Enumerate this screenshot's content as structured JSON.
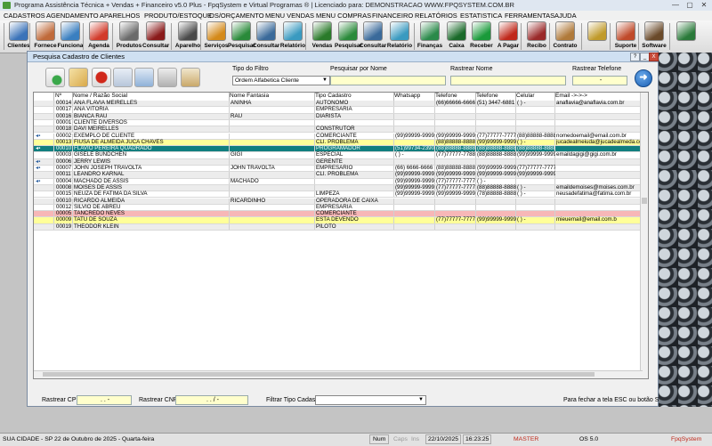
{
  "window": {
    "title": "Programa Assistência Técnica + Vendas + Financeiro v5.0 Plus - FpqSystem e Virtual Programas ® | Licenciado para: DEMONSTRACAO WWW.FPQSYSTEM.COM.BR",
    "minimize": "—",
    "maximize": "▢",
    "close": "✕"
  },
  "menu": [
    "CADASTROS",
    "AGENDAMENTO",
    "APARELHOS",
    "PRODUTO/ESTOQUE",
    "OS/ORÇAMENTO",
    "MENU VENDAS",
    "MENU COMPRAS",
    "FINANCEIRO",
    "RELATÓRIOS",
    "ESTATISTICA",
    "FERRAMENTAS",
    "AJUDA"
  ],
  "toolbar": [
    {
      "label": "Clientes",
      "icon": "clients-icon",
      "color": "#3b73b9"
    },
    {
      "label": "Fornece",
      "icon": "supplier-icon",
      "color": "#c06a3a"
    },
    {
      "label": "Funciona",
      "icon": "employee-icon",
      "color": "#3a7fc0"
    },
    {
      "label": "Agenda",
      "icon": "calendar-icon",
      "color": "#d23b2b"
    },
    {
      "label": "Produtos",
      "icon": "products-icon",
      "color": "#6a6a6a"
    },
    {
      "label": "Consultar",
      "icon": "consult-icon",
      "color": "#8a1a1a"
    },
    {
      "label": "Aparelho",
      "icon": "device-icon",
      "color": "#4a4a4a"
    },
    {
      "label": "Serviços",
      "icon": "services-icon",
      "color": "#d48a1a"
    },
    {
      "label": "Pesquisar",
      "icon": "search-icon",
      "color": "#2a8a3a"
    },
    {
      "label": "Consultar",
      "icon": "consult2-icon",
      "color": "#3a6a9a"
    },
    {
      "label": "Relatório",
      "icon": "report-icon",
      "color": "#3a9ac0"
    },
    {
      "label": "Vendas",
      "icon": "cart-icon",
      "color": "#2a7a2a"
    },
    {
      "label": "Pesquisar",
      "icon": "search2-icon",
      "color": "#2a8a3a"
    },
    {
      "label": "Consultar",
      "icon": "consult3-icon",
      "color": "#3a6a9a"
    },
    {
      "label": "Relatório",
      "icon": "report2-icon",
      "color": "#3a9ac0"
    },
    {
      "label": "Finanças",
      "icon": "finance-icon",
      "color": "#2a8a4a"
    },
    {
      "label": "Caixa",
      "icon": "cashier-icon",
      "color": "#1a6a2a"
    },
    {
      "label": "Receber",
      "icon": "receive-icon",
      "color": "#1a9a3a"
    },
    {
      "label": "A Pagar",
      "icon": "pay-icon",
      "color": "#c0281a"
    },
    {
      "label": "Recibo",
      "icon": "receipt-icon",
      "color": "#9a2a2a"
    },
    {
      "label": "Contrato",
      "icon": "contract-icon",
      "color": "#b07a3a"
    },
    {
      "label": "",
      "icon": "coins-icon",
      "color": "#c09a2a"
    },
    {
      "label": "Suporte",
      "icon": "support-icon",
      "color": "#c04a2a"
    },
    {
      "label": "Software",
      "icon": "software-icon",
      "color": "#6a4a2a"
    },
    {
      "label": "",
      "icon": "exit-icon",
      "color": "#2a7a3a"
    }
  ],
  "dialog": {
    "title": "Pesquisa Cadastro de Clientes",
    "btn_help": "?",
    "btn_min": "_",
    "btn_close": "X",
    "filter_label": "Tipo do Filtro",
    "filter_value": "Ordem Alfabetica Cliente",
    "search_name_label": "Pesquisar por Nome",
    "search_name_value": "",
    "track_name_label": "Rastrear Nome",
    "track_name_value": "",
    "track_phone_label": "Rastrear Telefone",
    "track_phone_value": "-",
    "columns": [
      "Nº",
      "Nome / Razão Social",
      "Nome Fantasia",
      "Tipo Cadastro",
      "Whatsapp",
      "Telefone",
      "Telefone",
      "Celular",
      "Email ->->->"
    ],
    "rows": [
      {
        "n": "00014",
        "nome": "ANA FLAVIA MEIRELLES",
        "fant": "ANINHA",
        "tipo": "AUTONOMO",
        "wa": "",
        "tel1": "(66)66666-6666",
        "tel2": "(51) 3447-6881",
        "cel": "( )    -",
        "email": "anaflavia@anaflavia.com.br",
        "bg": "#ececec",
        "fg": "#000",
        "mark": false
      },
      {
        "n": "00017",
        "nome": "ANA VITORIA",
        "fant": "",
        "tipo": "EMPRESARIA",
        "wa": "",
        "tel1": "",
        "tel2": "",
        "cel": "",
        "email": "",
        "bg": "#ffffff",
        "fg": "#000",
        "mark": false
      },
      {
        "n": "00016",
        "nome": "BIANCA RAU",
        "fant": "RAU",
        "tipo": "DIARISTA",
        "wa": "",
        "tel1": "",
        "tel2": "",
        "cel": "",
        "email": "",
        "bg": "#ececec",
        "fg": "#000",
        "mark": false
      },
      {
        "n": "00001",
        "nome": "CLIENTE DIVERSOS",
        "fant": "",
        "tipo": "",
        "wa": "",
        "tel1": "",
        "tel2": "",
        "cel": "",
        "email": "",
        "bg": "#ffffff",
        "fg": "#000",
        "mark": false
      },
      {
        "n": "00018",
        "nome": "DAVI MEIRELLES",
        "fant": "",
        "tipo": "CONSTRUTOR",
        "wa": "",
        "tel1": "",
        "tel2": "",
        "cel": "",
        "email": "",
        "bg": "#ececec",
        "fg": "#000",
        "mark": false
      },
      {
        "n": "00002",
        "nome": "EXEMPLO DE CLIENTE",
        "fant": "",
        "tipo": "COMERCIANTE",
        "wa": "(99)99999-9999",
        "tel1": "(99)99999-9999",
        "tel2": "(77)77777-7777",
        "cel": "(88)88888-8888",
        "email": "nomedoemail@email.com.br",
        "bg": "#ffffff",
        "fg": "#000",
        "mark": true
      },
      {
        "n": "00013",
        "nome": "FIUSA DE ALMEIDA JUCA CHAVES",
        "fant": "",
        "tipo": "CLI. PROBLEMA",
        "wa": "",
        "tel1": "(88)88888-8888",
        "tel2": "(99)99999-9999",
        "cel": "( )    -",
        "email": "jucadealmeiuda@jucadealmeda.com.br",
        "bg": "#ffff99",
        "fg": "#000",
        "mark": false
      },
      {
        "n": "00010",
        "nome": "FLAVIO PEREIRA QUADRADO",
        "fant": "",
        "tipo": "PROGRAMADOR",
        "wa": "(51)99734-2390",
        "tel1": "(88)88888-8888",
        "tel2": "(88)88888-8888",
        "cel": "(88)88888-8888",
        "email": "",
        "bg": "#117f7f",
        "fg": "#ffffff",
        "mark": true
      },
      {
        "n": "00003",
        "nome": "GISELE BUNDCHEN",
        "fant": "GIGI",
        "tipo": "ESPECIAL",
        "wa": "( )    -",
        "tel1": "(77)77777-7788",
        "tel2": "(88)88888-8888",
        "cel": "(99)99999-9999",
        "email": "emaildagigi@gigi.com.br",
        "bg": "#ffffff",
        "fg": "#000",
        "mark": false
      },
      {
        "n": "00006",
        "nome": "JERRY LEWIS",
        "fant": "",
        "tipo": "GERENTE",
        "wa": "",
        "tel1": "",
        "tel2": "",
        "cel": "",
        "email": "",
        "bg": "#ececec",
        "fg": "#000",
        "mark": true
      },
      {
        "n": "00007",
        "nome": "JOHN JOSEPH TRAVOLTA",
        "fant": "JOHN TRAVOLTA",
        "tipo": "EMPRESARIO",
        "wa": "(66) 6666-6666",
        "tel1": "(88)88888-8888",
        "tel2": "(99)99999-9999",
        "cel": "(77)77777-7777",
        "email": "",
        "bg": "#ffffff",
        "fg": "#000",
        "mark": true
      },
      {
        "n": "00011",
        "nome": "LEANDRO KARNAL",
        "fant": "",
        "tipo": "CLI. PROBLEMA",
        "wa": "(99)99999-9999",
        "tel1": "(99)99999-9999",
        "tel2": "(99)99999-9999",
        "cel": "(99)99999-9999",
        "email": "",
        "bg": "#ececec",
        "fg": "#000",
        "mark": false
      },
      {
        "n": "00004",
        "nome": "MACHADO DE ASSIS",
        "fant": "MACHADO",
        "tipo": "",
        "wa": "(99)99999-9999",
        "tel1": "(77)77777-7777",
        "tel2": "( )    -",
        "cel": "",
        "email": "",
        "bg": "#ffffff",
        "fg": "#000",
        "mark": true
      },
      {
        "n": "00008",
        "nome": "MOISES DE ASSIS",
        "fant": "",
        "tipo": "",
        "wa": "(99)99999-9999",
        "tel1": "(77)77777-7777",
        "tel2": "(88)88888-8888",
        "cel": "( )    -",
        "email": "emaildemoises@moises.com.br",
        "bg": "#ececec",
        "fg": "#000",
        "mark": false
      },
      {
        "n": "00015",
        "nome": "NEUZA DE FATIMA DA SILVA",
        "fant": "",
        "tipo": "LIMPEZA",
        "wa": "(99)99999-9999",
        "tel1": "(99)99999-9999",
        "tel2": "(78)88888-8888",
        "cel": "( )    -",
        "email": "neusadefatima@fatima.com.br",
        "bg": "#ffffff",
        "fg": "#000",
        "mark": false
      },
      {
        "n": "00010",
        "nome": "RICARDO ALMEIDA",
        "fant": "RICARDINHO",
        "tipo": "OPERADORA DE CAIXA",
        "wa": "",
        "tel1": "",
        "tel2": "",
        "cel": "",
        "email": "",
        "bg": "#ececec",
        "fg": "#000",
        "mark": false
      },
      {
        "n": "00012",
        "nome": "SILVIO DE ABREU",
        "fant": "",
        "tipo": "EMPRESARIA",
        "wa": "",
        "tel1": "",
        "tel2": "",
        "cel": "",
        "email": "",
        "bg": "#ffffff",
        "fg": "#000",
        "mark": false
      },
      {
        "n": "00005",
        "nome": "TANCREDO NEVES",
        "fant": "",
        "tipo": "COMERCIANTE",
        "wa": "",
        "tel1": "",
        "tel2": "",
        "cel": "",
        "email": "",
        "bg": "#f7b7b7",
        "fg": "#000",
        "mark": false
      },
      {
        "n": "00009",
        "nome": "TATU DE SOUZA",
        "fant": "",
        "tipo": "ESTA DEVENDO",
        "wa": "",
        "tel1": "(77)77777-7777",
        "tel2": "(99)99999-9999",
        "cel": "( )    -",
        "email": "mieuemail@email.com.b",
        "bg": "#ffff99",
        "fg": "#000",
        "mark": false
      },
      {
        "n": "00019",
        "nome": "THEODOR KLEIN",
        "fant": "",
        "tipo": "PILOTO",
        "wa": "",
        "tel1": "",
        "tel2": "",
        "cel": "",
        "email": "",
        "bg": "#ececec",
        "fg": "#000",
        "mark": false
      }
    ],
    "cpf_label": "Rastrear CPF",
    "cpf_value": ". .   -",
    "cnpj_label": "Rastrear CNPJ",
    "cnpj_value": ". .   /   -",
    "tipo_filter_label": "Filtrar Tipo Cadastro",
    "tipo_filter_value": "",
    "hint": "Para fechar a tela ESC ou botão SAIR"
  },
  "status": {
    "city": "SUA CIDADE - SP 22 de Outubro de 2025 - Quarta-feira",
    "num": "Num",
    "caps": "Caps",
    "ins": "Ins",
    "date": "22/10/2025",
    "time": "16:23:25",
    "master": "MASTER",
    "os": "OS 5.0",
    "brand": "FpqSystem"
  }
}
